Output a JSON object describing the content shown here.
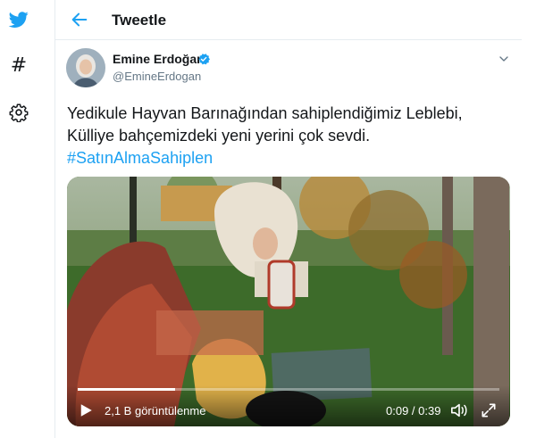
{
  "header": {
    "title": "Tweetle"
  },
  "nav": {
    "icons": [
      "twitter-bird-icon",
      "hashtag-icon",
      "gear-icon"
    ],
    "hash_glyph": "#"
  },
  "tweet": {
    "author_name": "Emine Erdoğan",
    "author_handle": "@EmineErdogan",
    "verified": true,
    "text_lines": [
      "Yedikule Hayvan Barınağından sahiplendiğimiz Leblebi,",
      "Külliye bahçemizdeki yeni yerini çok sevdi."
    ],
    "hashtag": "#SatınAlmaSahiplen"
  },
  "video": {
    "views": "2,1 B görüntülenme",
    "time": "0:09 / 0:39",
    "progress": 0.23
  },
  "colors": {
    "brand": "#1da1f2",
    "text": "#14171a",
    "muted": "#657786",
    "border": "#e6ecf0"
  }
}
